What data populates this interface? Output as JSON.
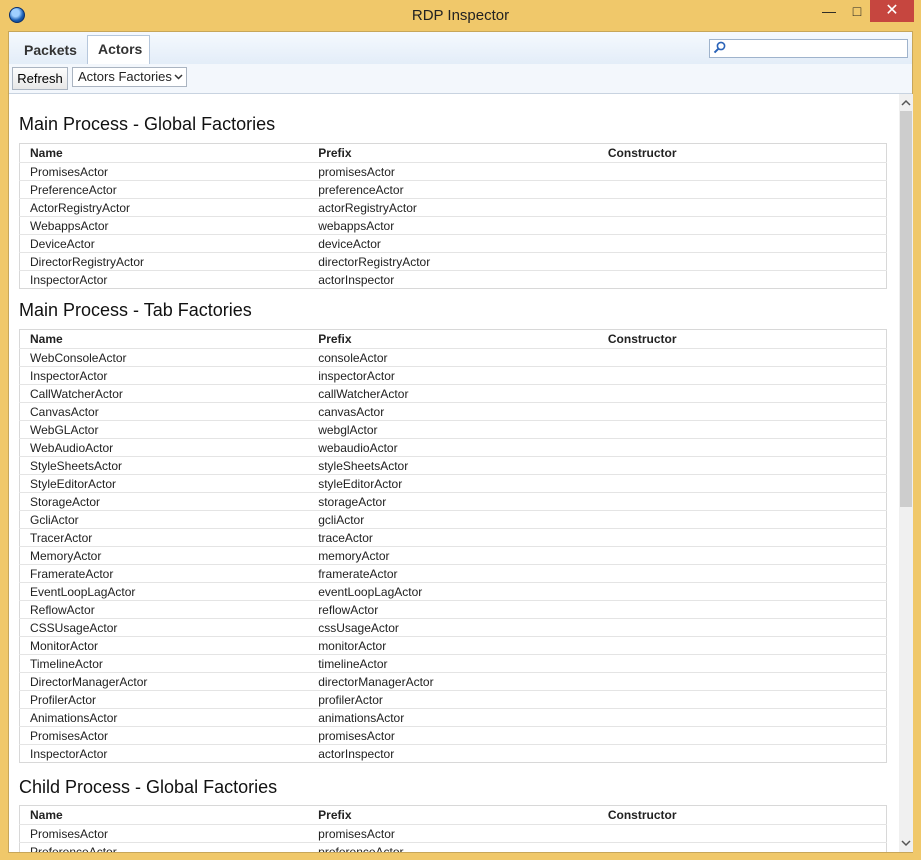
{
  "window": {
    "title": "RDP Inspector",
    "minimize_glyph": "—",
    "maximize_glyph": "□",
    "close_glyph": "✕"
  },
  "tabs": [
    {
      "label": "Packets"
    },
    {
      "label": "Actors"
    }
  ],
  "search": {
    "value": "",
    "placeholder": ""
  },
  "toolbar": {
    "refresh_label": "Refresh",
    "view_select": "Actors Factories"
  },
  "columns": {
    "name": "Name",
    "prefix": "Prefix",
    "constructor": "Constructor"
  },
  "sections": [
    {
      "title": "Main Process - Global Factories",
      "rows": [
        [
          "PromisesActor",
          "promisesActor",
          ""
        ],
        [
          "PreferenceActor",
          "preferenceActor",
          ""
        ],
        [
          "ActorRegistryActor",
          "actorRegistryActor",
          ""
        ],
        [
          "WebappsActor",
          "webappsActor",
          ""
        ],
        [
          "DeviceActor",
          "deviceActor",
          ""
        ],
        [
          "DirectorRegistryActor",
          "directorRegistryActor",
          ""
        ],
        [
          "InspectorActor",
          "actorInspector",
          ""
        ]
      ]
    },
    {
      "title": "Main Process - Tab Factories",
      "rows": [
        [
          "WebConsoleActor",
          "consoleActor",
          ""
        ],
        [
          "InspectorActor",
          "inspectorActor",
          ""
        ],
        [
          "CallWatcherActor",
          "callWatcherActor",
          ""
        ],
        [
          "CanvasActor",
          "canvasActor",
          ""
        ],
        [
          "WebGLActor",
          "webglActor",
          ""
        ],
        [
          "WebAudioActor",
          "webaudioActor",
          ""
        ],
        [
          "StyleSheetsActor",
          "styleSheetsActor",
          ""
        ],
        [
          "StyleEditorActor",
          "styleEditorActor",
          ""
        ],
        [
          "StorageActor",
          "storageActor",
          ""
        ],
        [
          "GcliActor",
          "gcliActor",
          ""
        ],
        [
          "TracerActor",
          "traceActor",
          ""
        ],
        [
          "MemoryActor",
          "memoryActor",
          ""
        ],
        [
          "FramerateActor",
          "framerateActor",
          ""
        ],
        [
          "EventLoopLagActor",
          "eventLoopLagActor",
          ""
        ],
        [
          "ReflowActor",
          "reflowActor",
          ""
        ],
        [
          "CSSUsageActor",
          "cssUsageActor",
          ""
        ],
        [
          "MonitorActor",
          "monitorActor",
          ""
        ],
        [
          "TimelineActor",
          "timelineActor",
          ""
        ],
        [
          "DirectorManagerActor",
          "directorManagerActor",
          ""
        ],
        [
          "ProfilerActor",
          "profilerActor",
          ""
        ],
        [
          "AnimationsActor",
          "animationsActor",
          ""
        ],
        [
          "PromisesActor",
          "promisesActor",
          ""
        ],
        [
          "InspectorActor",
          "actorInspector",
          ""
        ]
      ]
    },
    {
      "title": "Child Process - Global Factories",
      "rows": [
        [
          "PromisesActor",
          "promisesActor",
          ""
        ],
        [
          "PreferenceActor",
          "preferenceActor",
          ""
        ]
      ]
    }
  ]
}
